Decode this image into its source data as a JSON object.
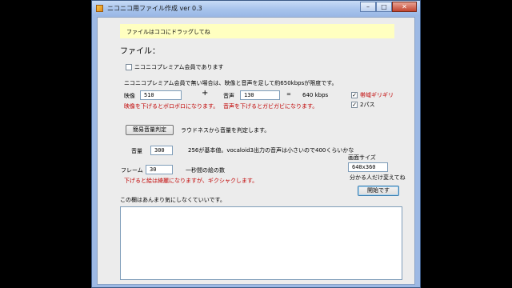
{
  "window": {
    "title": "ニコニコ用ファイル作成 ver 0.3"
  },
  "dropzone": {
    "text": "ファイルはココにドラッグしてね"
  },
  "file_label": "ファイル：",
  "premium_checkbox": {
    "label": "ニコニコプレミアム会員であります",
    "checked": false
  },
  "limit_note": "ニコニコプレミアム会員で無い場合は、映像と音声を足して約650kbpsが限度です。",
  "video": {
    "label": "映像",
    "value": "510",
    "warning": "映像を下げるとボロボロになります。"
  },
  "plus": "+",
  "audio": {
    "label": "音声",
    "value": "130",
    "warning": "音声を下げるとガビガビになります。"
  },
  "equals": "=",
  "total": "640 kbps",
  "bandwidth_checkbox": {
    "label": "帯域ギリギリ",
    "checked": true
  },
  "twopass_checkbox": {
    "label": "2パス",
    "checked": true
  },
  "volume_button": "簡易音量判定",
  "loudness_note": "ラウドネスから音量を判定します。",
  "volume": {
    "label": "音量",
    "value": "300",
    "note": "256が基本値。vocaloid3出力の音声は小さいので400くらいかな"
  },
  "screen_size": {
    "label": "画面サイズ",
    "value": "640x360",
    "note": "分かる人だけ変えてね"
  },
  "frame": {
    "label": "フレーム",
    "value": "30",
    "unit": "一秒間の絵の数",
    "warning": "下げると絵は綺麗になりますが、ギクシャクします。"
  },
  "start_button": "開始です",
  "log_label": "この欄はあんまり気にしなくていいです。",
  "log_text": ""
}
